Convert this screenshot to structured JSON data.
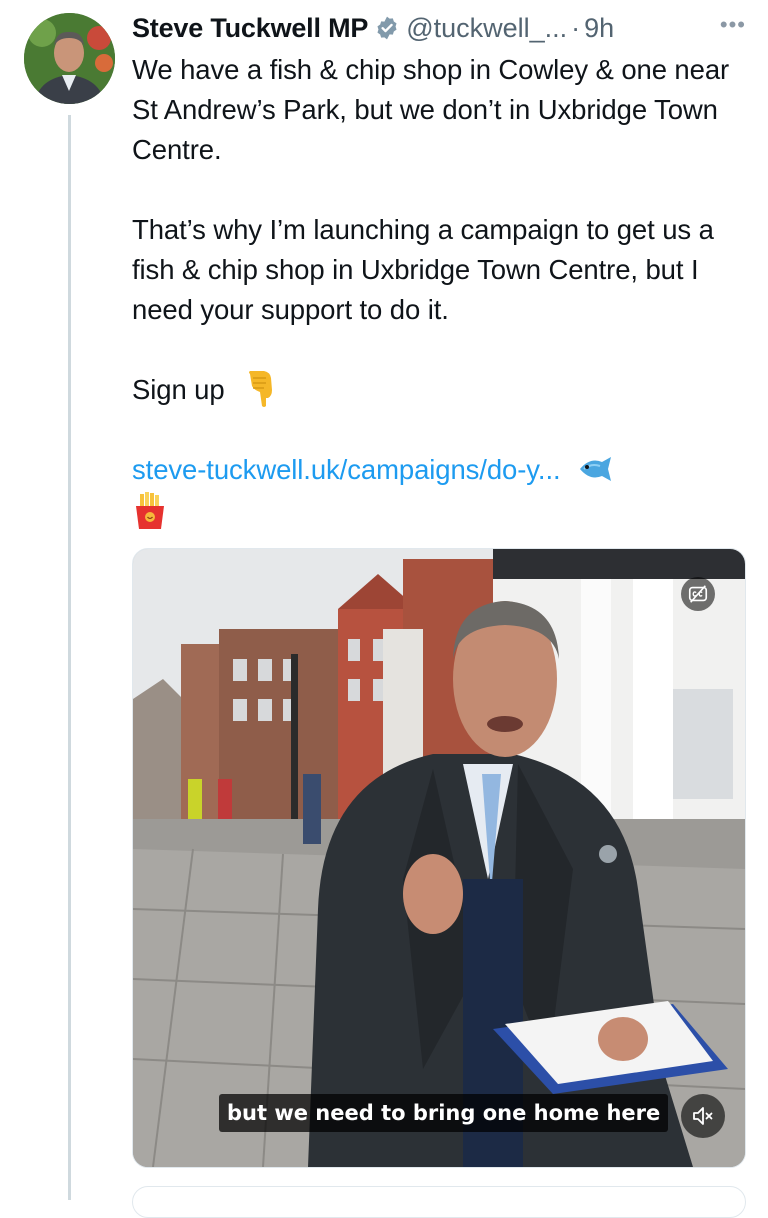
{
  "author": {
    "name": "Steve Tuckwell MP",
    "handle": "@tuckwell_...",
    "separator": "·",
    "time": "9h",
    "more_label": "•••",
    "verified_icon": "verified-badge-icon",
    "avatar_icon": "profile-photo"
  },
  "tweet": {
    "line1": "We have a fish & chip shop in Cowley & one near St Andrew’s Park, but we don’t in Uxbridge Town Centre.",
    "line2": "That’s why I’m launching a campaign to get us a fish & chip shop in Uxbridge Town Centre, but I need your support to do it.",
    "line3": "Sign up",
    "sign_up_emoji": "pointing-down-hand-icon",
    "link": "steve-tuckwell.uk/campaigns/do-y...",
    "fish_emoji": "fish-icon",
    "fries_emoji": "french-fries-icon"
  },
  "video": {
    "subtitle": "but we need to bring one home here",
    "captions_icon": "closed-captions-off-icon",
    "mute_icon": "muted-speaker-icon"
  },
  "colors": {
    "link": "#1d9bf0",
    "secondary_text": "#536471",
    "thread_line": "#cfd9de",
    "verified": "#829aab"
  }
}
